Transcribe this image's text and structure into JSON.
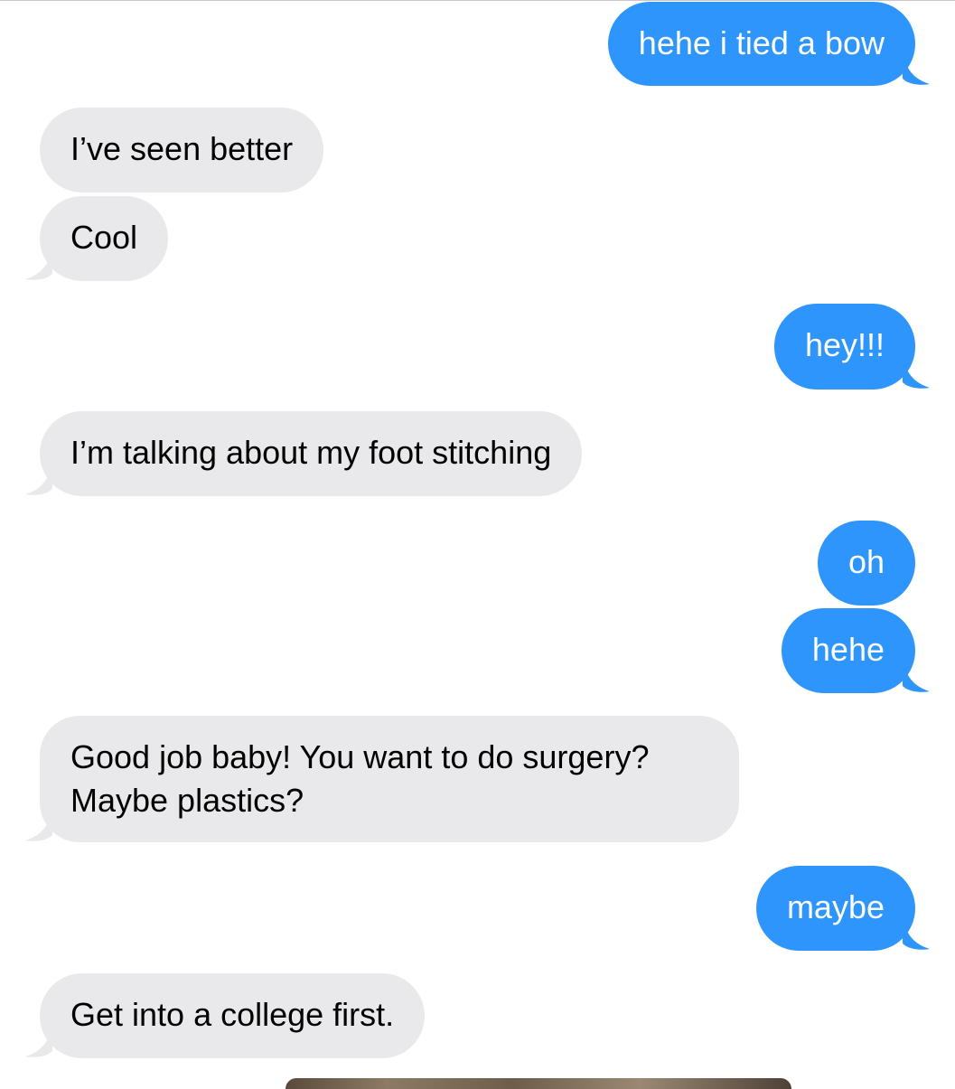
{
  "colors": {
    "sent_bubble": "#2d95fb",
    "received_bubble": "#e9e9eb",
    "sent_text": "#ffffff",
    "received_text": "#000000"
  },
  "messages": [
    {
      "direction": "sent",
      "text": "hehe i tied a bow"
    },
    {
      "direction": "received",
      "text": "I’ve seen better"
    },
    {
      "direction": "received",
      "text": "Cool"
    },
    {
      "direction": "sent",
      "text": "hey!!!"
    },
    {
      "direction": "received",
      "text": "I’m talking about my foot stitching"
    },
    {
      "direction": "sent",
      "text": "oh"
    },
    {
      "direction": "sent",
      "text": "hehe"
    },
    {
      "direction": "received",
      "lines": [
        "Good job baby! You want to do surgery?",
        "Maybe plastics?"
      ]
    },
    {
      "direction": "sent",
      "text": "maybe"
    },
    {
      "direction": "received",
      "text": "Get into a college first."
    }
  ],
  "attachment": {
    "type": "photo"
  }
}
